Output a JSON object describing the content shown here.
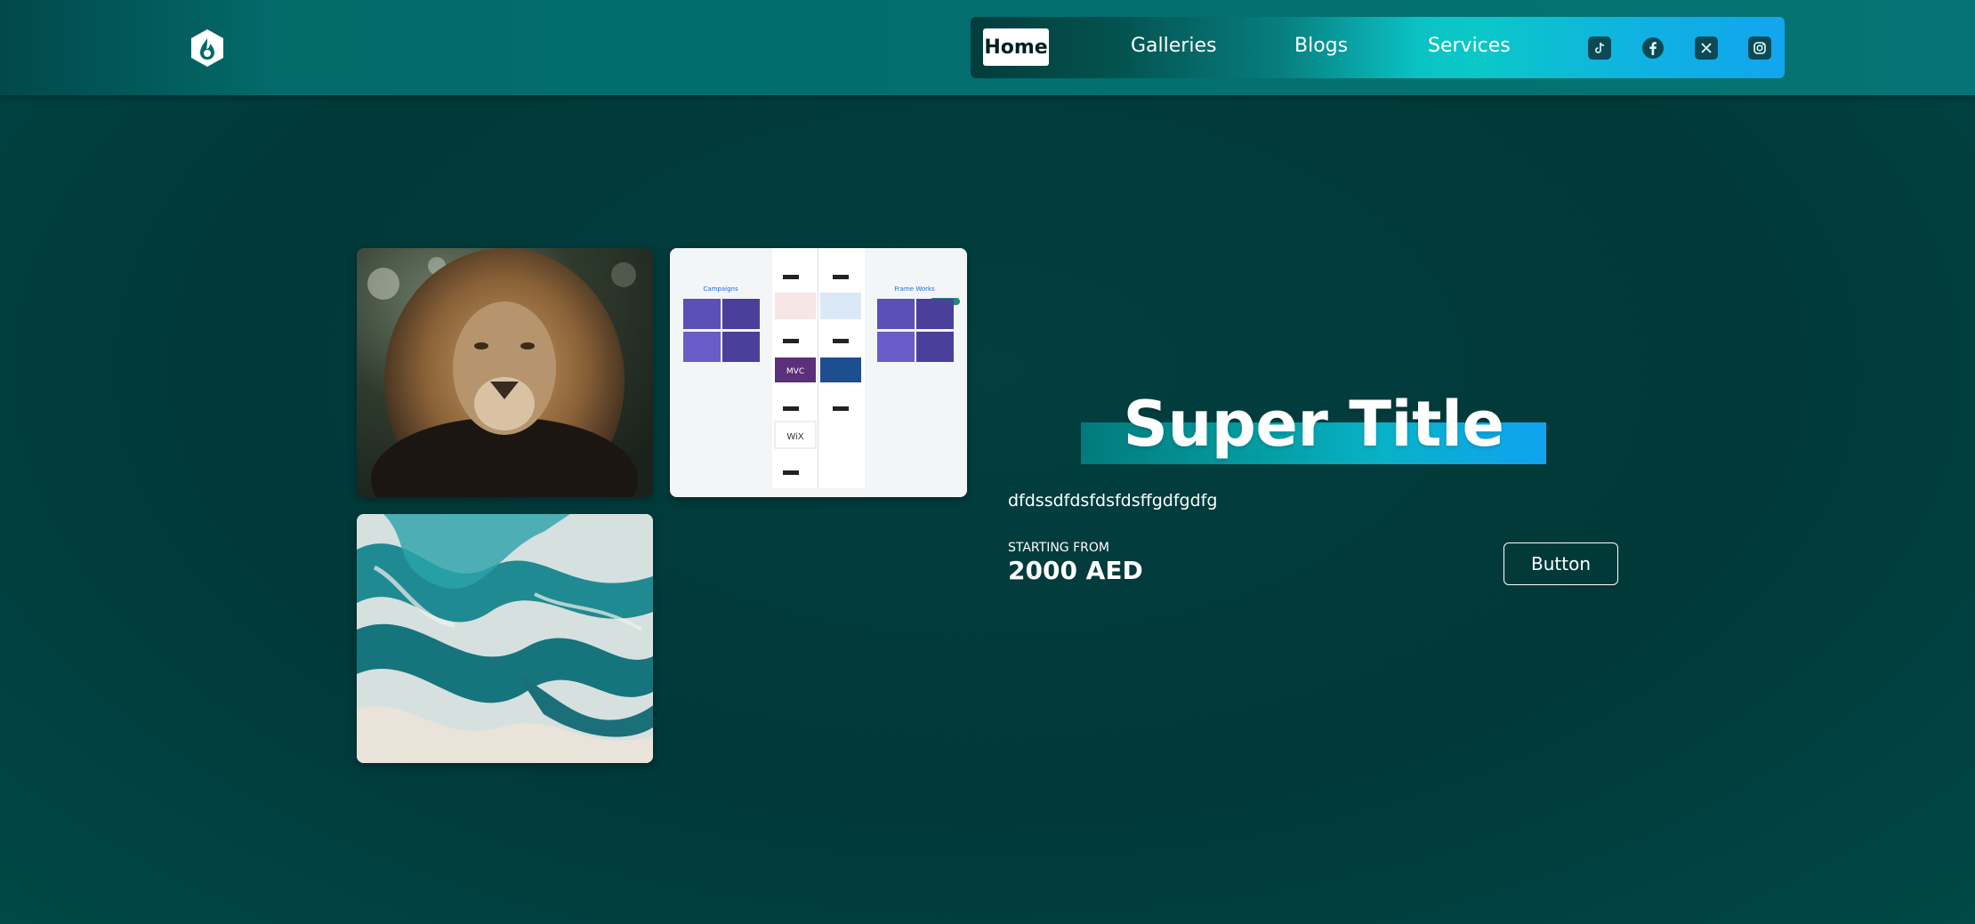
{
  "header": {
    "logo_icon": "brand-logo-icon",
    "nav": {
      "home": "Home",
      "galleries": "Galleries",
      "blogs": "Blogs",
      "services": "Services"
    },
    "social_icons": [
      "tiktok-icon",
      "facebook-icon",
      "x-icon",
      "instagram-icon"
    ]
  },
  "gallery": {
    "tiles": [
      {
        "name": "lion-image"
      },
      {
        "name": "website-screenshot-image"
      },
      {
        "name": "teal-marble-image"
      }
    ]
  },
  "hero": {
    "title": "Super Title",
    "subtitle": "dfdssdfdsfdsfdsffgdfgdfg",
    "price_label": "STARTING FROM",
    "price": "2000 AED",
    "button_label": "Button"
  },
  "colors": {
    "background": "#023d3d",
    "header": "#036e6e",
    "nav_gradient_end": "#12a5ef",
    "accent_teal": "#0bc2c4"
  }
}
